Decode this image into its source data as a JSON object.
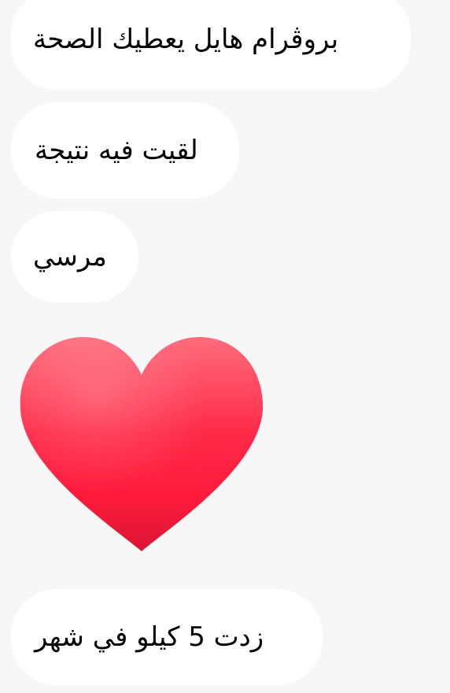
{
  "messages": [
    {
      "text": "بروڤرام هايل يعطيك الصحة"
    },
    {
      "text": "لقيت فيه نتيجة"
    },
    {
      "text": "مرسي"
    },
    {
      "emoji": "red-heart"
    },
    {
      "text": "زدت 5 كيلو في شهر"
    }
  ],
  "colors": {
    "background": "#f7f7f7",
    "bubble": "#ffffff",
    "text": "#000000",
    "heart_light": "#ff6b7c",
    "heart_main": "#ff1a3c",
    "heart_dark": "#d91432"
  }
}
